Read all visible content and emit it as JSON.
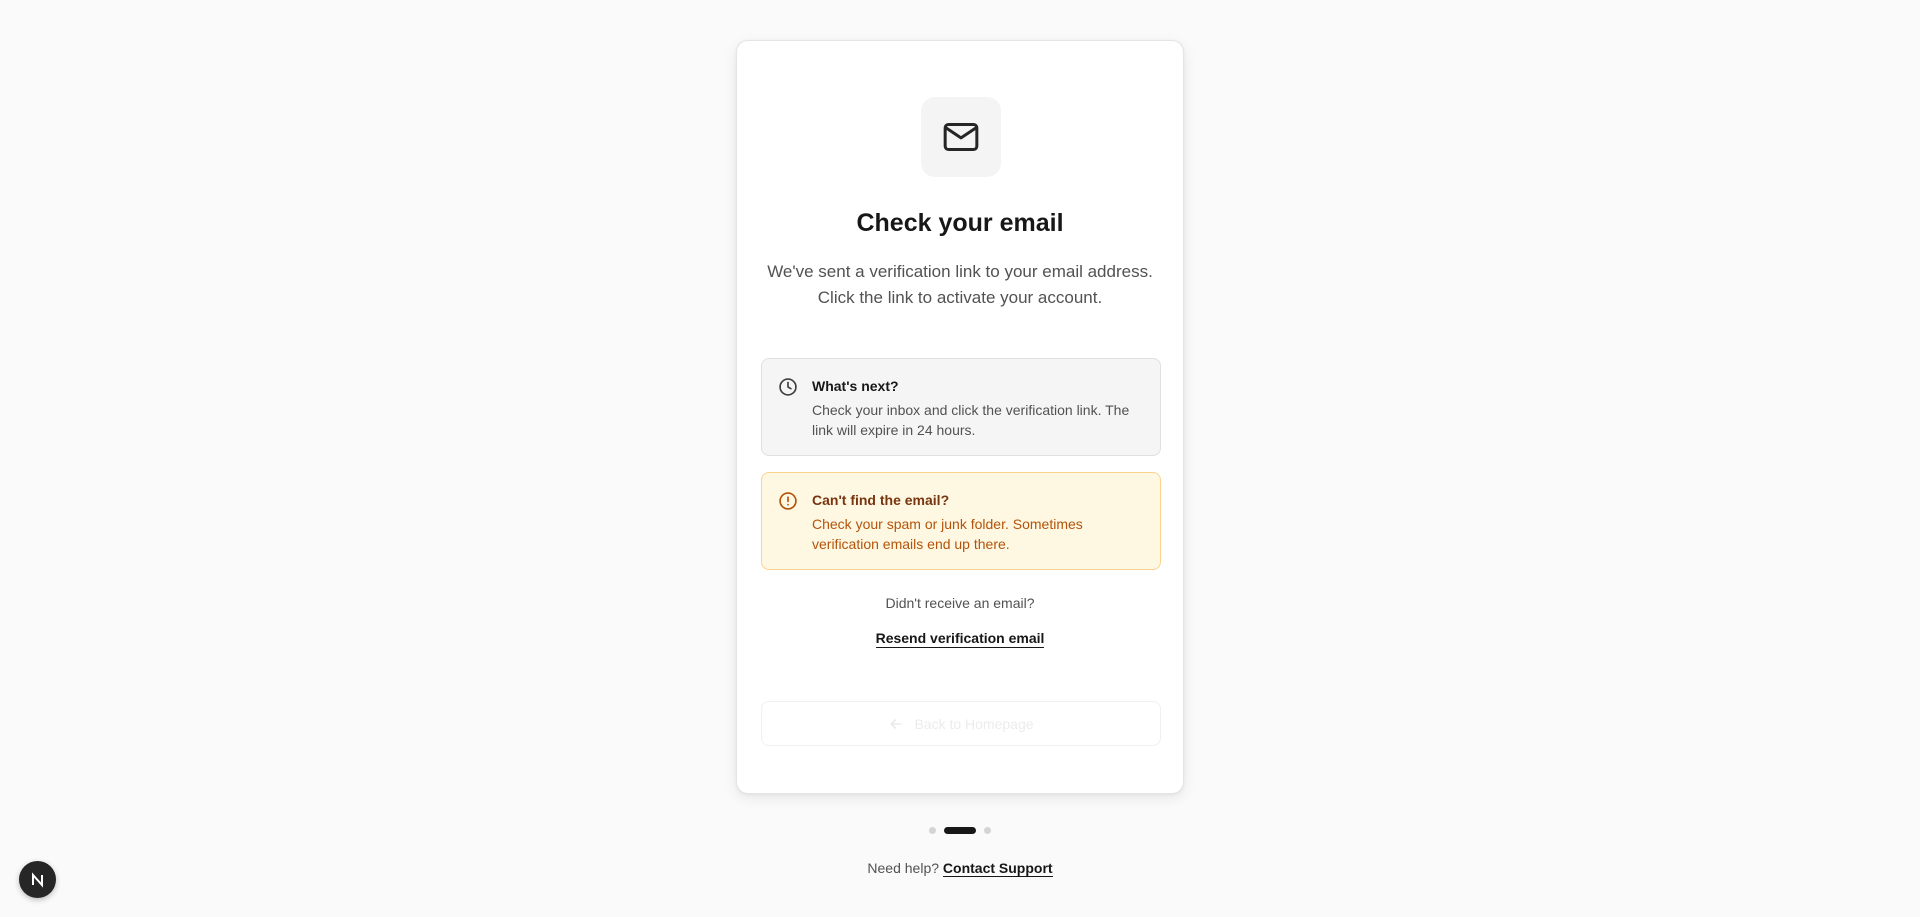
{
  "card": {
    "title": "Check your email",
    "subtitle": "We've sent a verification link to your email address. Click the link to activate your account.",
    "next_box": {
      "icon": "clock-icon",
      "title": "What's next?",
      "text": "Check your inbox and click the verification link. The link will expire in 24 hours."
    },
    "warning_box": {
      "icon": "alert-circle-icon",
      "title": "Can't find the email?",
      "text": "Check your spam or junk folder. Sometimes verification emails end up there."
    },
    "didnt_receive": "Didn't receive an email?",
    "resend_label": "Resend verification email",
    "back_label": "Back to Homepage"
  },
  "step_indicator": {
    "total": 3,
    "current": 2
  },
  "help": {
    "prefix": "Need help?",
    "link": "Contact Support"
  },
  "badge": {
    "letter": "N"
  },
  "colors": {
    "background": "#fafafa",
    "card": "#ffffff",
    "primary_text": "#171717",
    "muted_text": "#525252",
    "warning_bg": "#fef8e3",
    "warning_border": "#fbd38d",
    "warning_text": "#b45309"
  }
}
